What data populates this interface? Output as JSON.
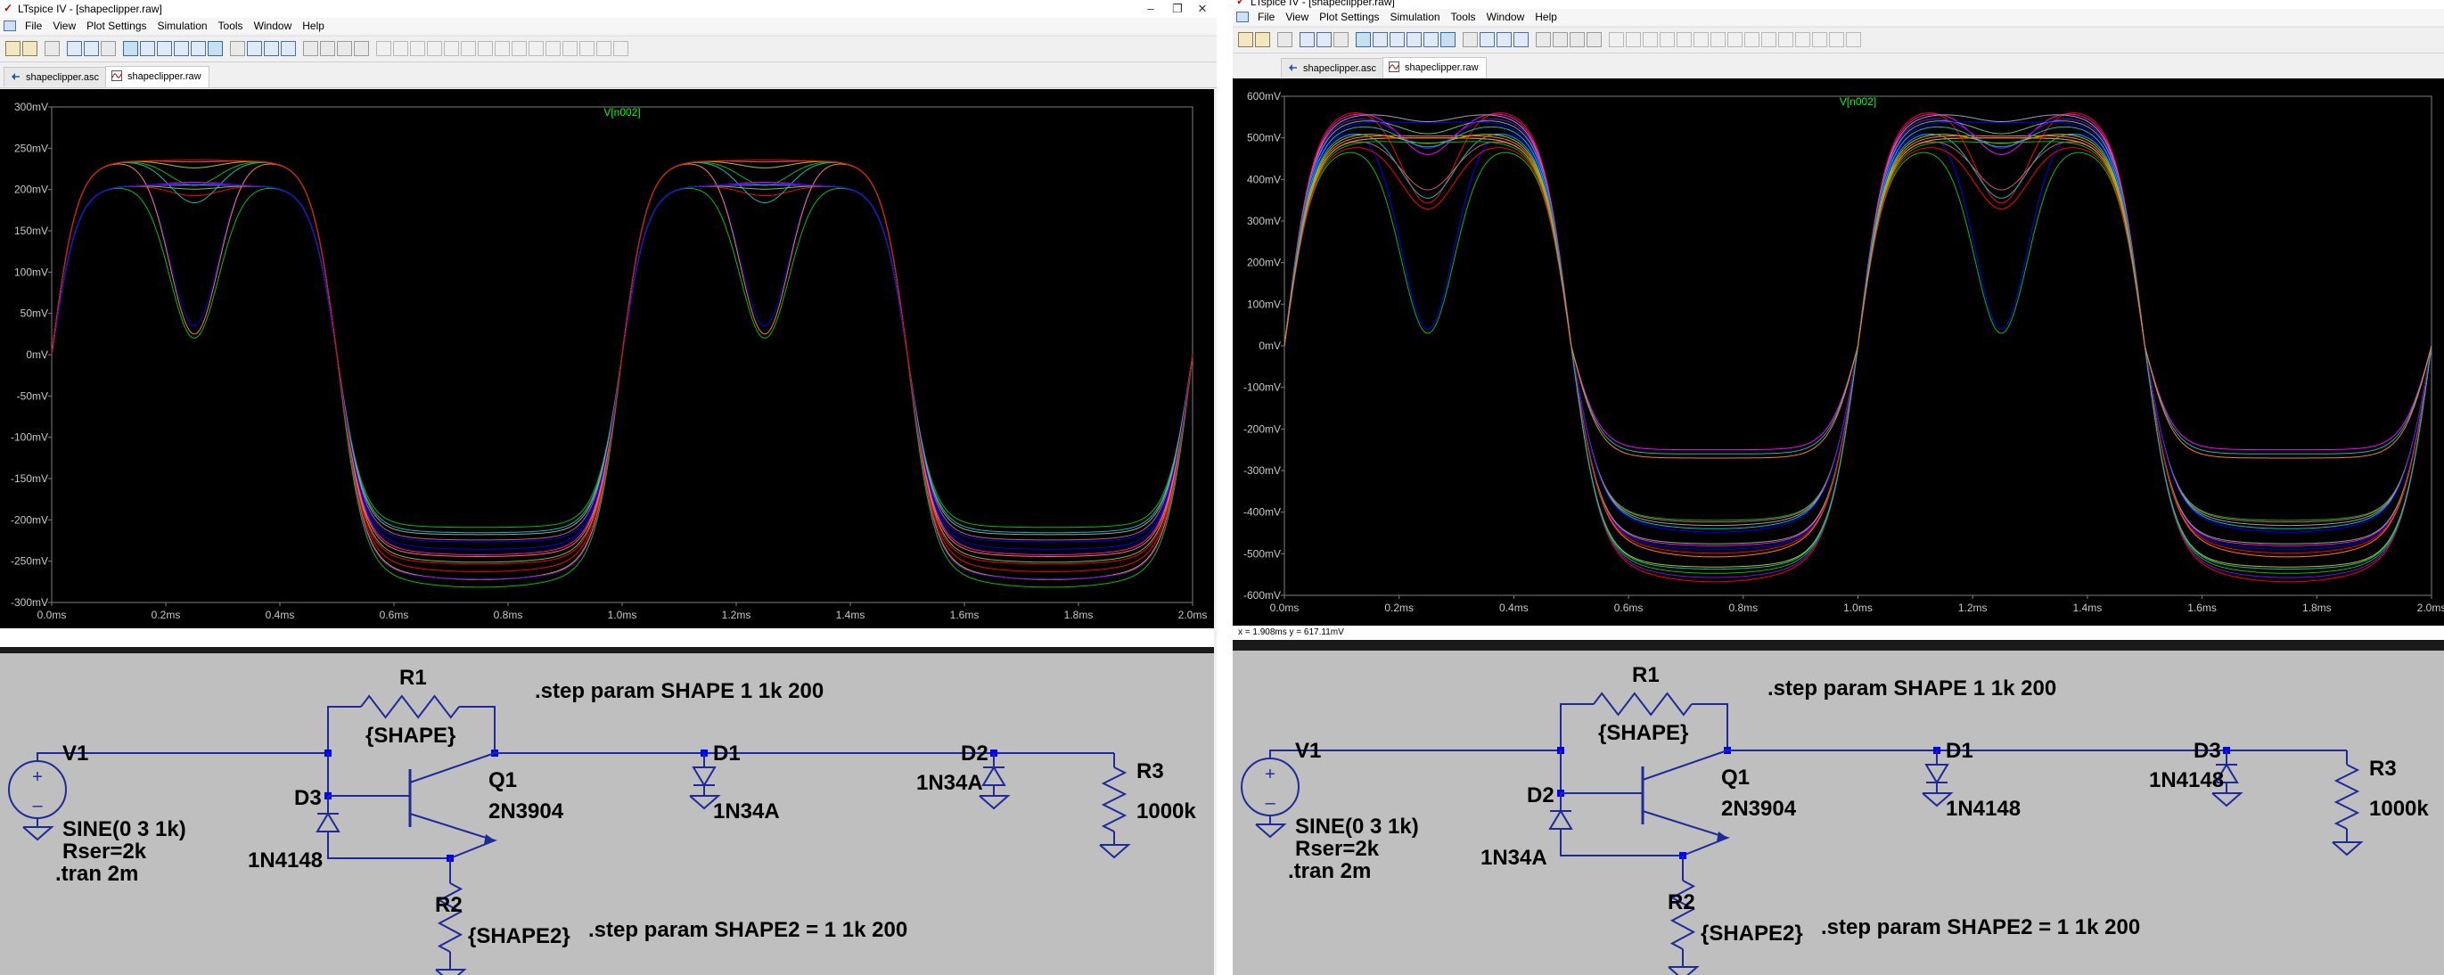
{
  "windows": [
    {
      "id": "left",
      "title": "LTspice IV - [shapeclipper.raw]",
      "menu": [
        "File",
        "View",
        "Plot Settings",
        "Simulation",
        "Tools",
        "Window",
        "Help"
      ],
      "tabs": [
        {
          "label": "shapeclipper.asc",
          "active": false
        },
        {
          "label": "shapeclipper.raw",
          "active": true
        }
      ],
      "plot": {
        "trace_label": "V[n002]",
        "y_ticks": [
          "300mV",
          "250mV",
          "200mV",
          "150mV",
          "100mV",
          "50mV",
          "0mV",
          "-50mV",
          "-100mV",
          "-150mV",
          "-200mV",
          "-250mV",
          "-300mV"
        ],
        "x_ticks": [
          "0.0ms",
          "0.2ms",
          "0.4ms",
          "0.6ms",
          "0.8ms",
          "1.0ms",
          "1.2ms",
          "1.4ms",
          "1.6ms",
          "1.8ms",
          "2.0ms"
        ]
      },
      "status": "",
      "schematic": {
        "labels": {
          "R1": "R1",
          "R1_value": "{SHAPE}",
          "step1": ".step param SHAPE 1 1k 200",
          "V1": "V1",
          "V1_value": "SINE(0 3 1k)",
          "rser": "Rser=2k",
          "tran": ".tran 2m",
          "Q1": "Q1",
          "Q1_model": "2N3904",
          "Dclamp": "D3",
          "Dclamp_model": "1N4148",
          "Dmid": "D1",
          "Dmid_model": "1N34A",
          "Dend": "D2",
          "Dend_model": "1N34A",
          "R3": "R3",
          "R3_value": "1000k",
          "R2": "R2",
          "R2_value": "{SHAPE2}",
          "step2": ".step param SHAPE2 = 1 1k 200"
        }
      }
    },
    {
      "id": "right",
      "title": "LTspice IV - [shapeclipper.raw]",
      "menu": [
        "File",
        "View",
        "Plot Settings",
        "Simulation",
        "Tools",
        "Window",
        "Help"
      ],
      "tabs": [
        {
          "label": "shapeclipper.asc",
          "active": false
        },
        {
          "label": "shapeclipper.raw",
          "active": true
        }
      ],
      "plot": {
        "trace_label": "V[n002]",
        "y_ticks": [
          "600mV",
          "500mV",
          "400mV",
          "300mV",
          "200mV",
          "100mV",
          "0mV",
          "-100mV",
          "-200mV",
          "-300mV",
          "-400mV",
          "-500mV",
          "-600mV"
        ],
        "x_ticks": [
          "0.0ms",
          "0.2ms",
          "0.4ms",
          "0.6ms",
          "0.8ms",
          "1.0ms",
          "1.2ms",
          "1.4ms",
          "1.6ms",
          "1.8ms",
          "2.0ms"
        ]
      },
      "status": "x = 1.908ms    y = 617.11mV",
      "schematic": {
        "labels": {
          "R1": "R1",
          "R1_value": "{SHAPE}",
          "step1": ".step param SHAPE 1 1k 200",
          "V1": "V1",
          "V1_value": "SINE(0 3 1k)",
          "rser": "Rser=2k",
          "tran": ".tran 2m",
          "Q1": "Q1",
          "Q1_model": "2N3904",
          "Dclamp": "D2",
          "Dclamp_model": "1N34A",
          "Dmid": "D1",
          "Dmid_model": "1N4148",
          "Dend": "D3",
          "Dend_model": "1N4148",
          "R3": "R3",
          "R3_value": "1000k",
          "R2": "R2",
          "R2_value": "{SHAPE2}",
          "step2": ".step param SHAPE2 = 1 1k 200"
        }
      }
    }
  ],
  "colors": {
    "plot_bg": "#000000",
    "axis_label": "#c8c8c8",
    "trace_title": "#00ff00",
    "schematic_bg": "#bfbfbf",
    "wire": "#1e2a9a",
    "component": "#1e2a9a",
    "junction": "#0000ff",
    "schematic_text": "#000000",
    "traces": [
      "#00c000",
      "#0000ff",
      "#ff0000",
      "#00c0c0",
      "#ff00ff",
      "#c0c000",
      "#a0a0a0",
      "#ff8000",
      "#8000ff",
      "#c06060",
      "#60c060"
    ]
  }
}
